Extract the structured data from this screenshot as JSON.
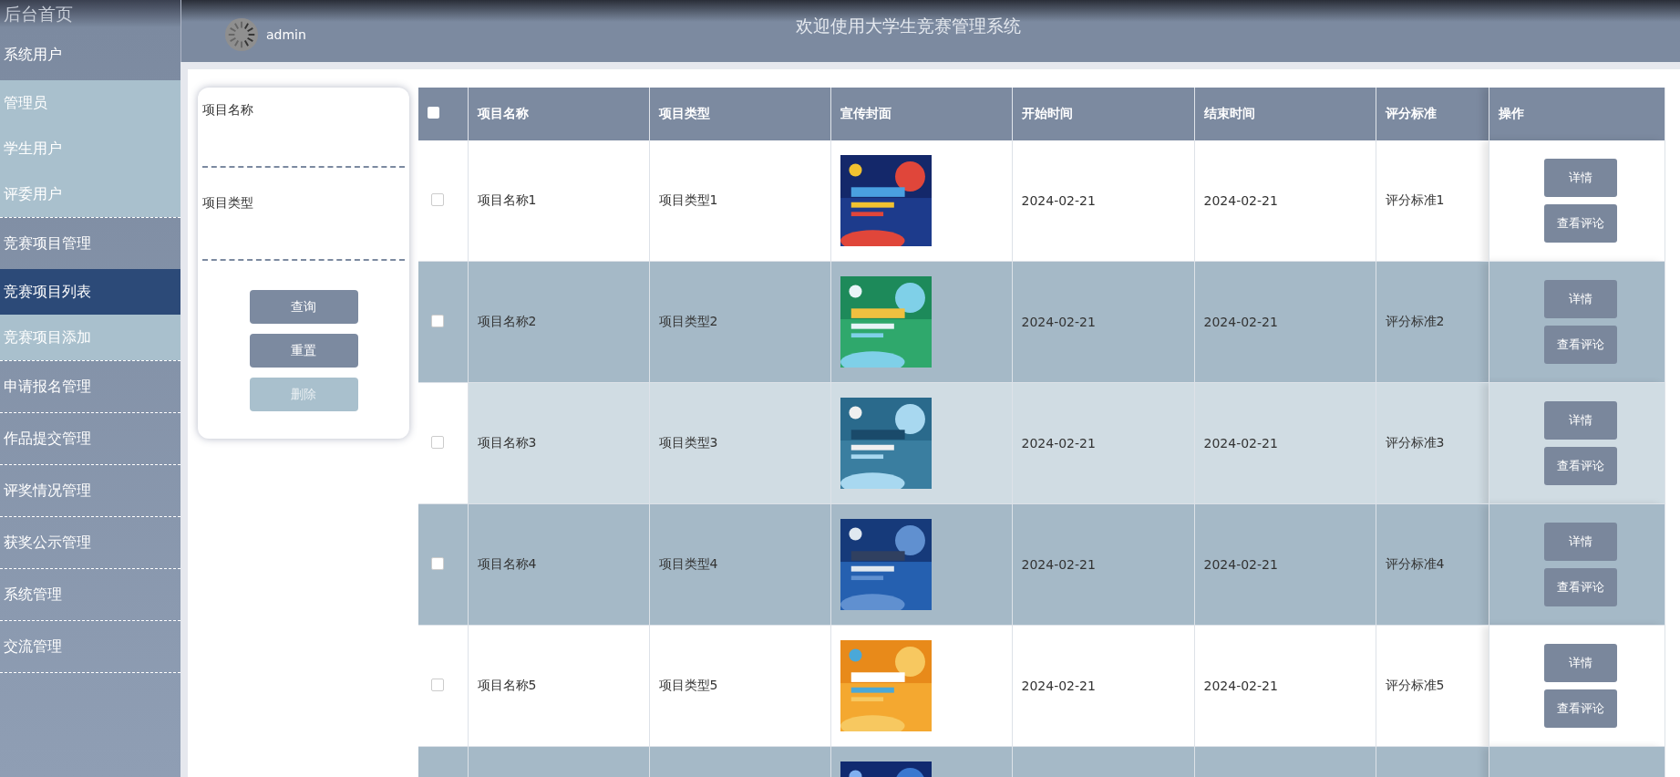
{
  "sidebar": {
    "items": [
      {
        "label": "后台首页",
        "kind": "home"
      },
      {
        "label": "系统用户",
        "kind": "group",
        "selected": false,
        "expanded": true,
        "children": [
          {
            "label": "管理员",
            "selected": false
          },
          {
            "label": "学生用户",
            "selected": false
          },
          {
            "label": "评委用户",
            "selected": false
          }
        ]
      },
      {
        "label": "竞赛项目管理",
        "kind": "group",
        "selected": false,
        "expanded": true,
        "children": [
          {
            "label": "竞赛项目列表",
            "selected": true
          },
          {
            "label": "竞赛项目添加",
            "selected": false
          }
        ]
      },
      {
        "label": "申请报名管理",
        "kind": "group",
        "selected": false
      },
      {
        "label": "作品提交管理",
        "kind": "group",
        "selected": false
      },
      {
        "label": "评奖情况管理",
        "kind": "group",
        "selected": false
      },
      {
        "label": "获奖公示管理",
        "kind": "group",
        "selected": false
      },
      {
        "label": "系统管理",
        "kind": "group",
        "selected": false
      },
      {
        "label": "交流管理",
        "kind": "group",
        "selected": false
      }
    ]
  },
  "header": {
    "user": "admin",
    "title": "欢迎使用大学生竞赛管理系统"
  },
  "search": {
    "fields": [
      {
        "label": "项目名称"
      },
      {
        "label": "项目类型"
      }
    ],
    "buttons": [
      {
        "label": "查询",
        "disabled": false
      },
      {
        "label": "重置",
        "disabled": false
      },
      {
        "label": "删除",
        "disabled": true
      }
    ]
  },
  "table": {
    "all_checked": false,
    "columns": [
      "项目名称",
      "项目类型",
      "宣传封面",
      "开始时间",
      "结束时间",
      "评分标准",
      "操作"
    ],
    "rows": [
      {
        "name": "项目名称1",
        "type": "项目类型1",
        "start": "2024-02-21",
        "end": "2024-02-21",
        "standard": "评分标准1",
        "checked": false,
        "hovered": false,
        "actions": [
          "详情",
          "查看评论"
        ]
      },
      {
        "name": "项目名称2",
        "type": "项目类型2",
        "start": "2024-02-21",
        "end": "2024-02-21",
        "standard": "评分标准2",
        "checked": false,
        "hovered": false,
        "actions": [
          "详情",
          "查看评论"
        ]
      },
      {
        "name": "项目名称3",
        "type": "项目类型3",
        "start": "2024-02-21",
        "end": "2024-02-21",
        "standard": "评分标准3",
        "checked": false,
        "hovered": true,
        "actions": [
          "详情",
          "查看评论"
        ]
      },
      {
        "name": "项目名称4",
        "type": "项目类型4",
        "start": "2024-02-21",
        "end": "2024-02-21",
        "standard": "评分标准4",
        "checked": false,
        "hovered": false,
        "actions": [
          "详情",
          "查看评论"
        ]
      },
      {
        "name": "项目名称5",
        "type": "项目类型5",
        "start": "2024-02-21",
        "end": "2024-02-21",
        "standard": "评分标准5",
        "checked": false,
        "hovered": false,
        "actions": [
          "详情",
          "查看评论"
        ]
      },
      {
        "hovered": false
      }
    ]
  }
}
